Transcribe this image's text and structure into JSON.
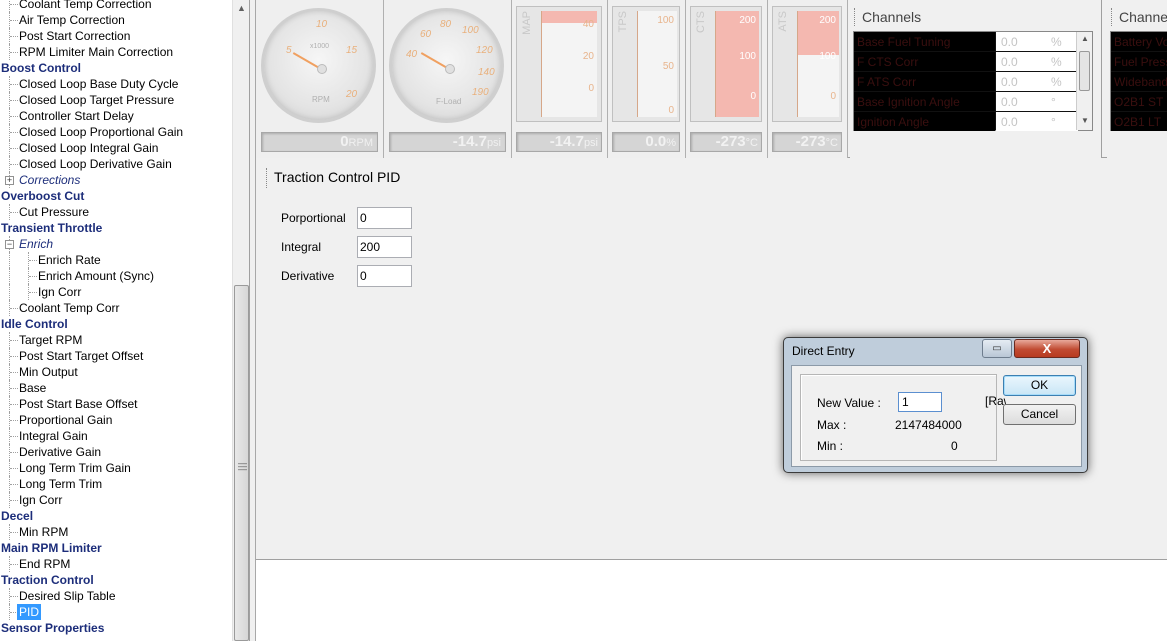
{
  "tree": [
    {
      "label": "Coolant Temp Correction",
      "type": "item",
      "level": 1
    },
    {
      "label": "Air Temp Correction",
      "type": "item",
      "level": 1
    },
    {
      "label": "Post Start Correction",
      "type": "item",
      "level": 1
    },
    {
      "label": "RPM Limiter Main Correction",
      "type": "item",
      "level": 1
    },
    {
      "label": "Boost Control",
      "type": "cat",
      "level": 0
    },
    {
      "label": "Closed Loop Base Duty Cycle",
      "type": "item",
      "level": 1
    },
    {
      "label": "Closed Loop Target Pressure",
      "type": "item",
      "level": 1
    },
    {
      "label": "Controller Start Delay",
      "type": "item",
      "level": 1
    },
    {
      "label": "Closed Loop Proportional Gain",
      "type": "item",
      "level": 1
    },
    {
      "label": "Closed Loop Integral Gain",
      "type": "item",
      "level": 1
    },
    {
      "label": "Closed Loop Derivative Gain",
      "type": "item",
      "level": 1
    },
    {
      "label": "Corrections",
      "type": "grp",
      "level": 1,
      "expander": "+"
    },
    {
      "label": "Overboost Cut",
      "type": "cat",
      "level": 0
    },
    {
      "label": "Cut Pressure",
      "type": "item",
      "level": 1
    },
    {
      "label": "Transient Throttle",
      "type": "cat",
      "level": 0
    },
    {
      "label": "Enrich",
      "type": "grp",
      "level": 1,
      "expander": "−"
    },
    {
      "label": "Enrich Rate",
      "type": "item",
      "level": 2
    },
    {
      "label": "Enrich Amount (Sync)",
      "type": "item",
      "level": 2
    },
    {
      "label": "Ign Corr",
      "type": "item",
      "level": 2
    },
    {
      "label": "Coolant Temp Corr",
      "type": "item",
      "level": 1
    },
    {
      "label": "Idle Control",
      "type": "cat",
      "level": 0
    },
    {
      "label": "Target RPM",
      "type": "item",
      "level": 1
    },
    {
      "label": "Post Start Target Offset",
      "type": "item",
      "level": 1
    },
    {
      "label": "Min Output",
      "type": "item",
      "level": 1
    },
    {
      "label": "Base",
      "type": "item",
      "level": 1
    },
    {
      "label": "Post Start Base Offset",
      "type": "item",
      "level": 1
    },
    {
      "label": "Proportional Gain",
      "type": "item",
      "level": 1
    },
    {
      "label": "Integral Gain",
      "type": "item",
      "level": 1
    },
    {
      "label": "Derivative Gain",
      "type": "item",
      "level": 1
    },
    {
      "label": "Long Term Trim Gain",
      "type": "item",
      "level": 1
    },
    {
      "label": "Long Term Trim",
      "type": "item",
      "level": 1
    },
    {
      "label": "Ign Corr",
      "type": "item",
      "level": 1
    },
    {
      "label": "Decel",
      "type": "cat",
      "level": 0
    },
    {
      "label": "Min RPM",
      "type": "item",
      "level": 1
    },
    {
      "label": "Main RPM Limiter",
      "type": "cat",
      "level": 0
    },
    {
      "label": "End RPM",
      "type": "item",
      "level": 1
    },
    {
      "label": "Traction Control",
      "type": "cat",
      "level": 0
    },
    {
      "label": "Desired Slip Table",
      "type": "item",
      "level": 1
    },
    {
      "label": "PID",
      "type": "item",
      "level": 1,
      "selected": true
    },
    {
      "label": "Sensor Properties",
      "type": "cat",
      "level": 0
    }
  ],
  "gauges": {
    "rpm": {
      "unit": "RPM",
      "value": "0",
      "dial_unit": "x1000",
      "ticks": [
        "5",
        "10",
        "15",
        "20"
      ]
    },
    "fload": {
      "unit": "psi",
      "value": "-14.7",
      "dial_unit": "F-Load",
      "ticks": [
        "40",
        "60",
        "80",
        "100",
        "120",
        "140",
        "190"
      ]
    },
    "map": {
      "label": "MAP",
      "ticks": [
        "40",
        "20",
        "0"
      ],
      "value": "-14.7",
      "unit": "psi"
    },
    "tps": {
      "label": "TPS",
      "ticks": [
        "100",
        "50",
        "0"
      ],
      "value": "0.0",
      "unit": "%"
    },
    "cts": {
      "label": "CTS",
      "ticks": [
        "200",
        "100",
        "0"
      ],
      "value": "-273",
      "unit": "°C"
    },
    "ats": {
      "label": "ATS",
      "ticks": [
        "200",
        "100",
        "0"
      ],
      "value": "-273",
      "unit": "°C"
    }
  },
  "channels1": {
    "title": "Channels",
    "rows": [
      {
        "name": "Base Fuel Tuning",
        "value": "0.0",
        "unit": "%"
      },
      {
        "name": "F CTS Corr",
        "value": "0.0",
        "unit": "%"
      },
      {
        "name": "F ATS Corr",
        "value": "0.0",
        "unit": "%"
      },
      {
        "name": "Base Ignition Angle",
        "value": "0.0",
        "unit": "°"
      },
      {
        "name": "Ignition Angle",
        "value": "0.0",
        "unit": "°"
      }
    ]
  },
  "channels2": {
    "title": "Channels",
    "rows": [
      {
        "name": "Battery Vo"
      },
      {
        "name": "Fuel Press"
      },
      {
        "name": "Wideband"
      },
      {
        "name": "O2B1 ST"
      },
      {
        "name": "O2B1 LT"
      }
    ]
  },
  "editor": {
    "title": "Traction Control PID",
    "fields": [
      {
        "label": "Porportional",
        "value": "0"
      },
      {
        "label": "Integral",
        "value": "200"
      },
      {
        "label": "Derivative",
        "value": "0"
      }
    ]
  },
  "dialog": {
    "caption": "Direct Entry",
    "new_value_label": "New Value :",
    "new_value": "1",
    "raw_label": "[Raw",
    "max_label": "Max :",
    "max_value": "2147484000",
    "min_label": "Min :",
    "min_value": "0",
    "ok_label": "OK",
    "cancel_label": "Cancel",
    "close_glyph": "X",
    "restore_glyph": "▭"
  },
  "colors": {
    "category": "#1c2d7a",
    "selection": "#3399ff",
    "gauge_accent": "#e9b07c"
  }
}
